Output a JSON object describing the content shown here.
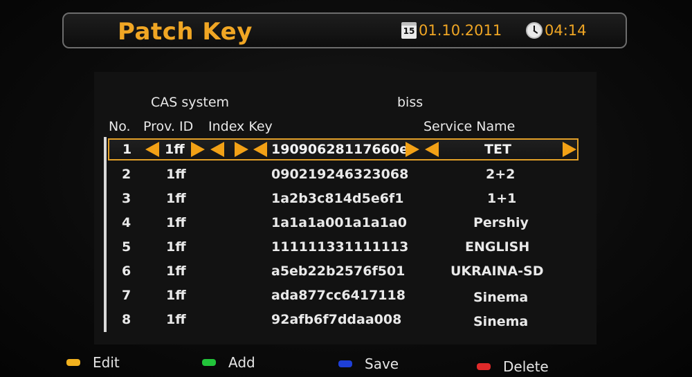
{
  "header": {
    "title": "Patch Key",
    "date_icon_day": "15",
    "date": "01.10.2011",
    "time": "04:14"
  },
  "cas": {
    "label": "CAS system",
    "value": "biss"
  },
  "columns": {
    "no": "No.",
    "prov_id": "Prov. ID",
    "index_key": "Index Key",
    "service_name": "Service Name"
  },
  "rows": [
    {
      "no": "1",
      "prov": "1ff",
      "key": "19090628117660e",
      "service": "TET"
    },
    {
      "no": "2",
      "prov": "1ff",
      "key": "090219246323068",
      "service": "2+2"
    },
    {
      "no": "3",
      "prov": "1ff",
      "key": "1a2b3c814d5e6f1",
      "service": "1+1"
    },
    {
      "no": "4",
      "prov": "1ff",
      "key": "1a1a1a001a1a1a0",
      "service": "Pershiy"
    },
    {
      "no": "5",
      "prov": "1ff",
      "key": "111111331111113",
      "service": "ENGLISH"
    },
    {
      "no": "6",
      "prov": "1ff",
      "key": "a5eb22b2576f501",
      "service": "UKRAINA-SD"
    },
    {
      "no": "7",
      "prov": "1ff",
      "key": "ada877cc6417118",
      "service": "Sinema"
    },
    {
      "no": "8",
      "prov": "1ff",
      "key": "92afb6f7ddaa008",
      "service": "Sinema"
    }
  ],
  "selected_row_index": 0,
  "footer": {
    "edit": {
      "label": "Edit",
      "color": "#f2b21f"
    },
    "add": {
      "label": "Add",
      "color": "#22c43a"
    },
    "save": {
      "label": "Save",
      "color": "#1e3fd8"
    },
    "delete": {
      "label": "Delete",
      "color": "#e02a2a"
    }
  },
  "colors": {
    "accent": "#f0a624",
    "selection_border": "#e3a028",
    "arrow": "#f2a116"
  }
}
